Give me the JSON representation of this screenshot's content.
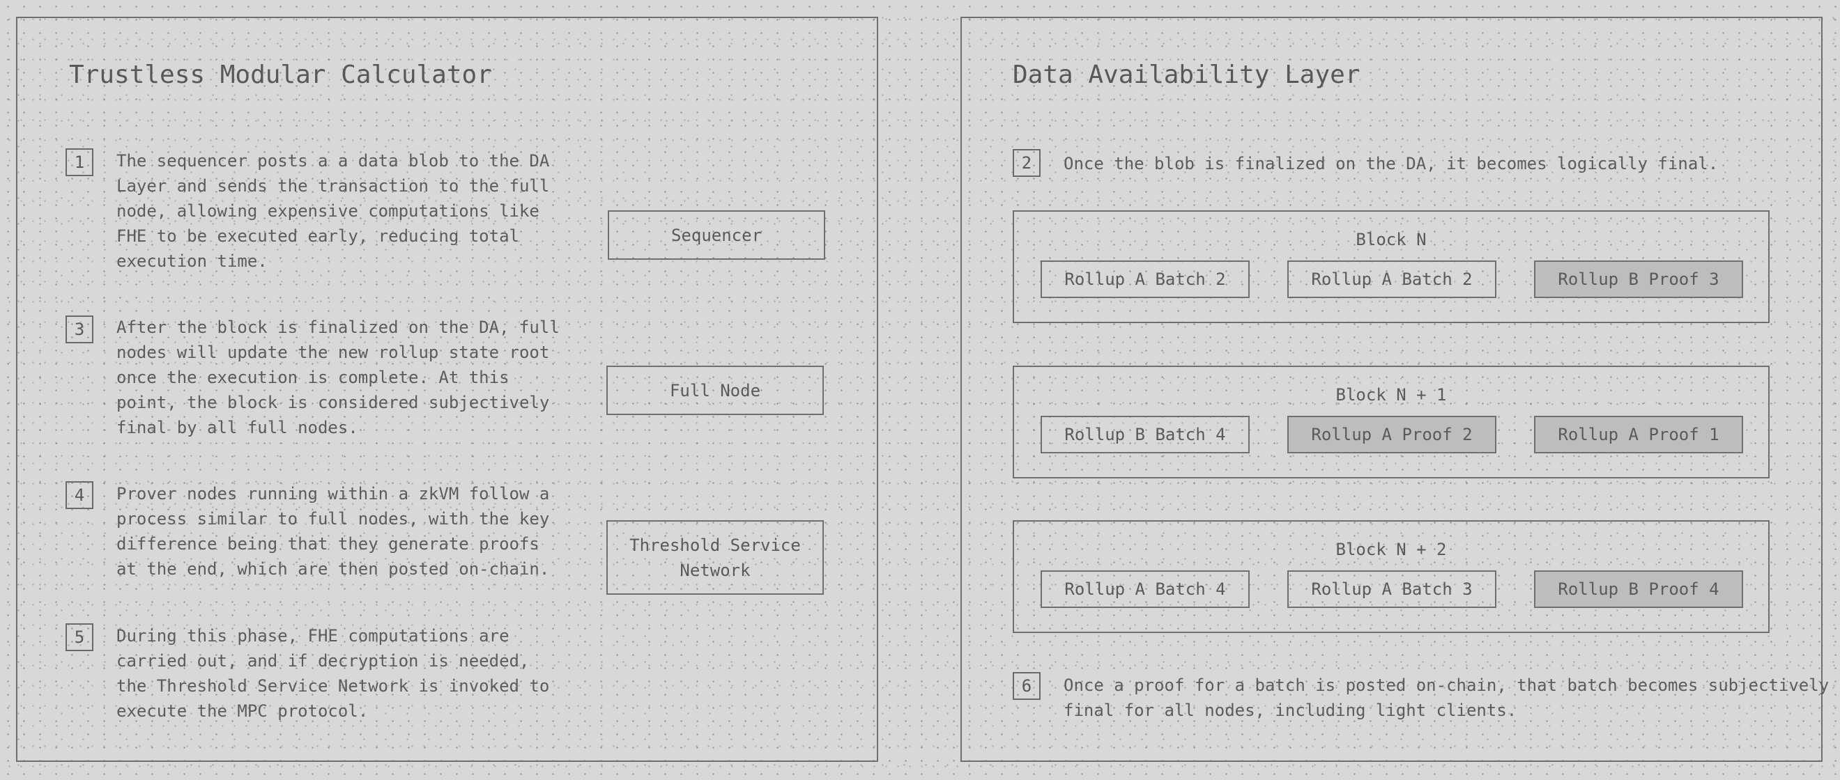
{
  "left_panel": {
    "title": "Trustless Modular Calculator",
    "steps": [
      {
        "number": "1",
        "text": "The sequencer posts a a data blob to the DA\nLayer and sends the transaction to the full\nnode, allowing expensive computations like\nFHE to be executed early, reducing total\nexecution time."
      },
      {
        "number": "3",
        "text": "After the block is finalized on the DA, full\nnodes will update the new rollup state root\nonce the execution is complete. At this\npoint, the block is considered subjectively\nfinal by all full nodes."
      },
      {
        "number": "4",
        "text": "Prover nodes running within a zkVM follow a\nprocess similar to full nodes, with the key\ndifference being that they generate proofs\nat the end, which are then posted on-chain."
      },
      {
        "number": "5",
        "text": "During this phase, FHE computations are\ncarried out, and if decryption is needed,\nthe Threshold Service Network is invoked to\nexecute the MPC protocol."
      }
    ],
    "actors": [
      {
        "label": "Sequencer"
      },
      {
        "label": "Full Node"
      },
      {
        "label": "Threshold Service\nNetwork"
      }
    ]
  },
  "right_panel": {
    "title": "Data Availability Layer",
    "step_top": {
      "number": "2",
      "text": "Once the blob is finalized on the DA, it becomes logically final."
    },
    "blocks": [
      {
        "title": "Block N",
        "items": [
          {
            "label": "Rollup A Batch 2",
            "kind": "batch"
          },
          {
            "label": "Rollup A Batch 2",
            "kind": "batch"
          },
          {
            "label": "Rollup B Proof 3",
            "kind": "proof"
          }
        ]
      },
      {
        "title": "Block N + 1",
        "items": [
          {
            "label": "Rollup B Batch 4",
            "kind": "batch"
          },
          {
            "label": "Rollup A Proof 2",
            "kind": "proof"
          },
          {
            "label": "Rollup A Proof 1",
            "kind": "proof"
          }
        ]
      },
      {
        "title": "Block N + 2",
        "items": [
          {
            "label": "Rollup A Batch 4",
            "kind": "batch"
          },
          {
            "label": "Rollup A Batch 3",
            "kind": "batch"
          },
          {
            "label": "Rollup B Proof 4",
            "kind": "proof"
          }
        ]
      }
    ],
    "step_bottom": {
      "number": "6",
      "text": "Once a proof for a batch is posted on-chain, that batch becomes subjectively\nfinal for all nodes, including light clients."
    }
  },
  "colors": {
    "background": "#d8d8d8",
    "border": "#6f6f6f",
    "text": "#5a5a5a",
    "proof_fill": "#bdbdbd"
  }
}
